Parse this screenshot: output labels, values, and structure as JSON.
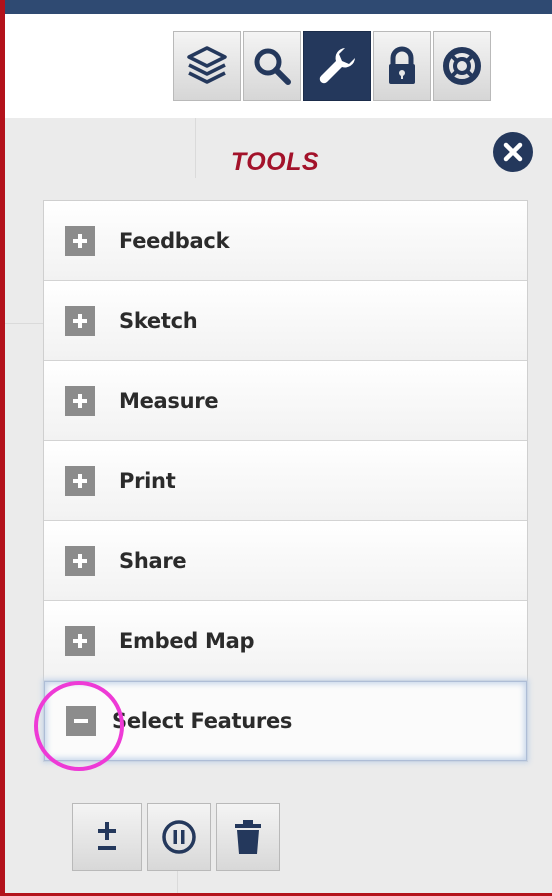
{
  "toolbar": {
    "buttons": [
      {
        "icon": "layers-icon",
        "active": false
      },
      {
        "icon": "search-icon",
        "active": false
      },
      {
        "icon": "wrench-icon",
        "active": true
      },
      {
        "icon": "lock-icon",
        "active": false
      },
      {
        "icon": "lifebuoy-icon",
        "active": false
      }
    ]
  },
  "panel": {
    "title": "TOOLS",
    "close_icon": "close-icon"
  },
  "tools": [
    {
      "label": "Feedback",
      "expanded": false
    },
    {
      "label": "Sketch",
      "expanded": false
    },
    {
      "label": "Measure",
      "expanded": false
    },
    {
      "label": "Print",
      "expanded": false
    },
    {
      "label": "Share",
      "expanded": false
    },
    {
      "label": "Embed Map",
      "expanded": false
    },
    {
      "label": "Select Features",
      "expanded": true
    }
  ],
  "select_features_tools": [
    {
      "icon": "plus-minus-icon"
    },
    {
      "icon": "pause-icon"
    },
    {
      "icon": "trash-icon"
    }
  ],
  "colors": {
    "accent_dark": "#24385c",
    "title_red": "#a3122a",
    "highlight_ring": "#ee3ad6"
  }
}
